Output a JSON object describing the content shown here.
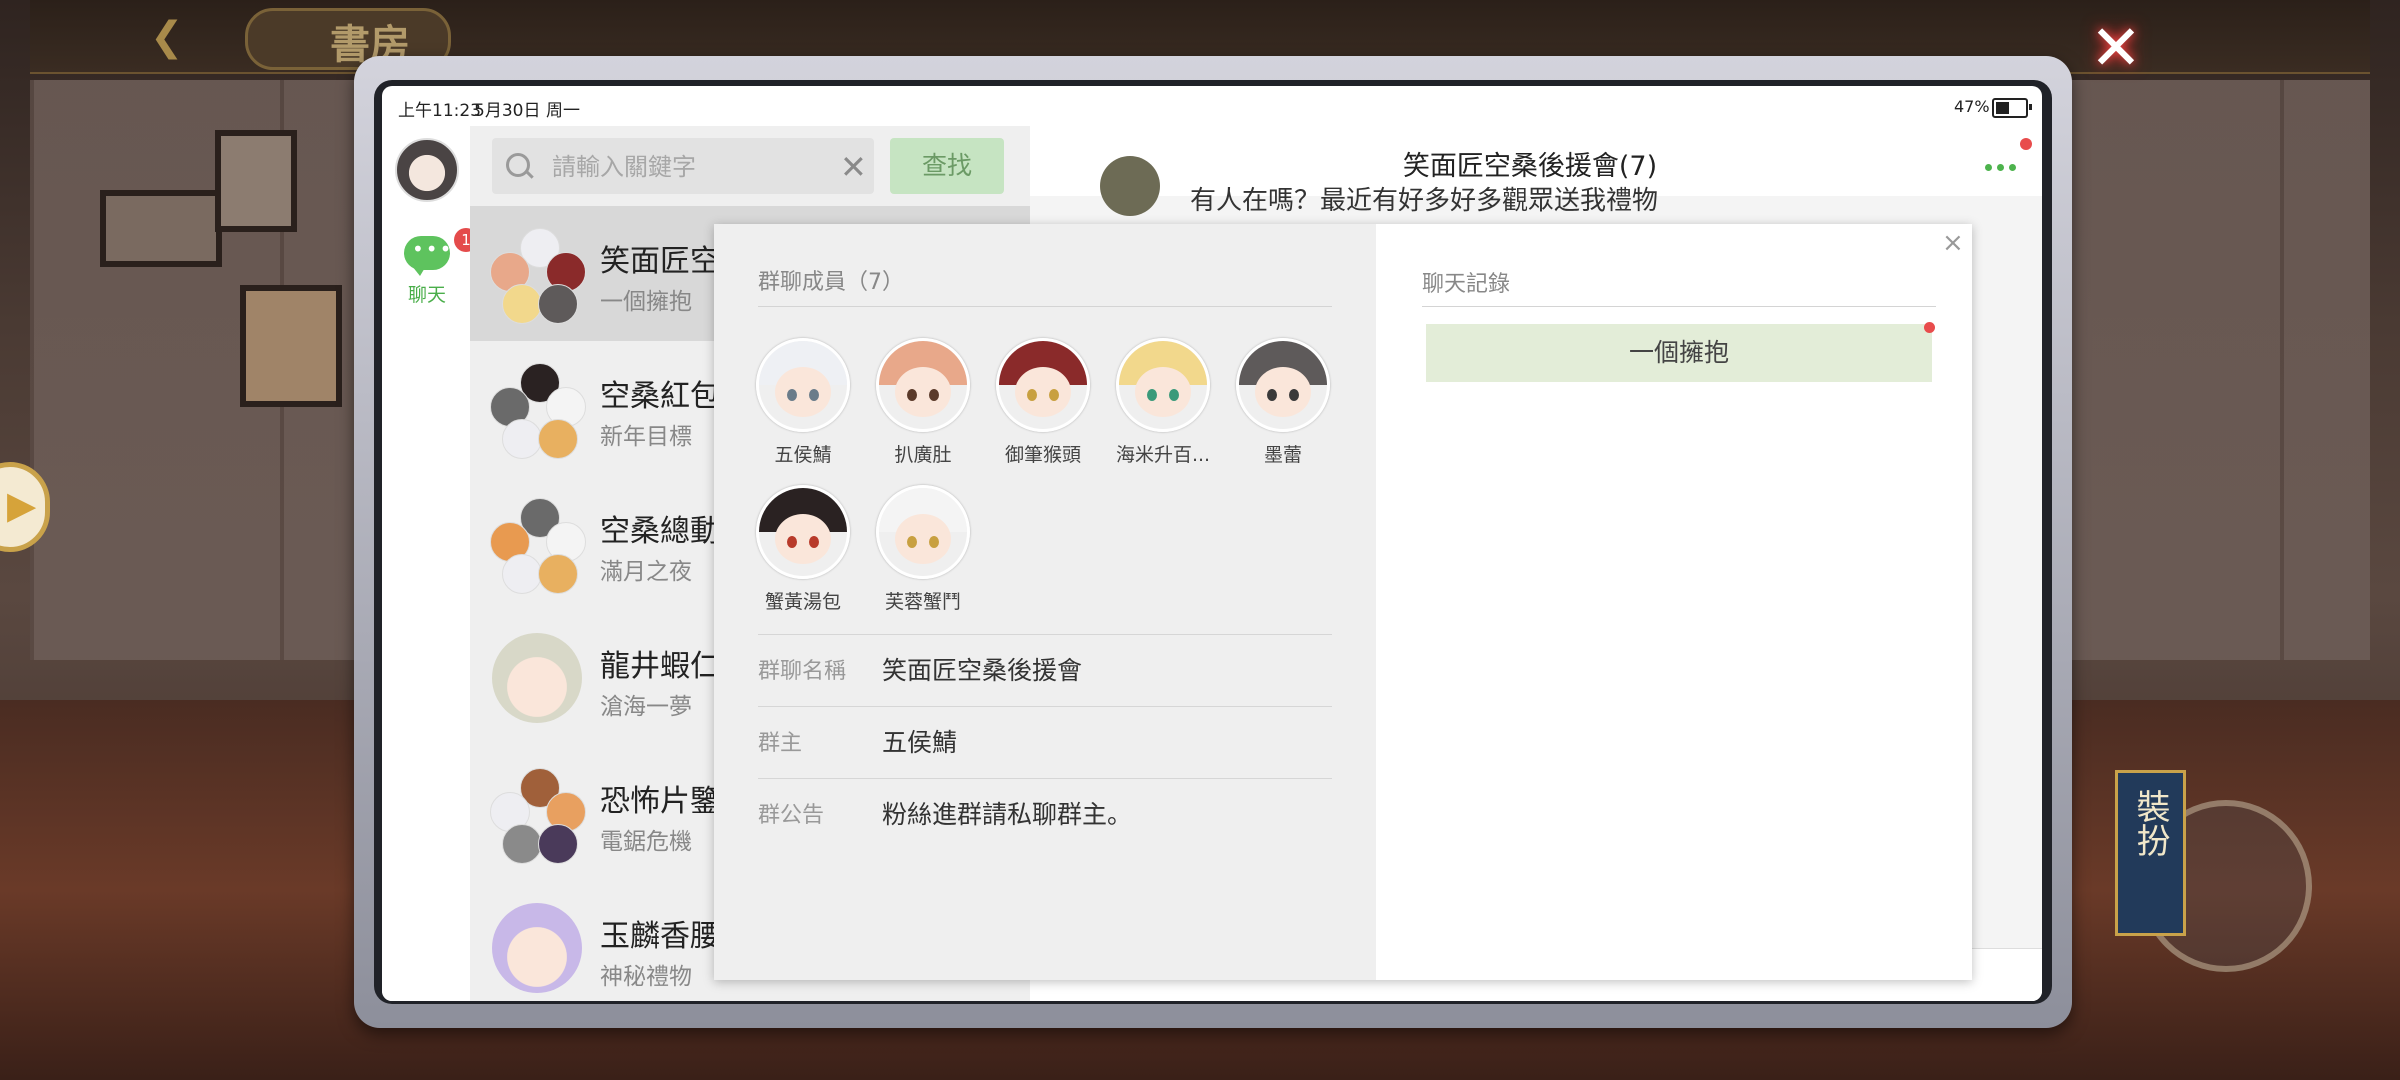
{
  "status": {
    "time": "上午11:23",
    "date": "5月30日",
    "weekday": "周一",
    "battery_text": "47%",
    "battery_level": 0.47
  },
  "background": {
    "title": "書房",
    "dress_label": "裝扮"
  },
  "rail": {
    "chat_label": "聊天",
    "chat_badge": "1"
  },
  "search": {
    "placeholder": "請輸入關鍵字",
    "button": "查找"
  },
  "conversations": [
    {
      "name": "笑面匠空",
      "sub": "一個擁抱"
    },
    {
      "name": "空桑紅包",
      "sub": "新年目標"
    },
    {
      "name": "空桑總動",
      "sub": "滿月之夜"
    },
    {
      "name": "龍井蝦仁",
      "sub": "滄海一夢"
    },
    {
      "name": "恐怖片鑒",
      "sub": "電鋸危機"
    },
    {
      "name": "玉麟香腰",
      "sub": "神秘禮物"
    }
  ],
  "chat": {
    "title": "笑面匠空桑後援會(7)",
    "peek_text": "有人在嗎？最近有好多好多觀眾送我禮物"
  },
  "popup": {
    "members_title": "群聊成員（7）",
    "members": [
      {
        "name": "五侯鯖",
        "hair": "#eef0f4",
        "eye": "#6a7c8a"
      },
      {
        "name": "扒廣肚",
        "hair": "#e8a88a",
        "eye": "#5a3a2a"
      },
      {
        "name": "御筆猴頭",
        "hair": "#8a2a2a",
        "eye": "#c8a040"
      },
      {
        "name": "海米升百...",
        "hair": "#f2d88c",
        "eye": "#3a9a7a"
      },
      {
        "name": "墨蕾",
        "hair": "#5e5a5a",
        "eye": "#3a3a3a"
      },
      {
        "name": "蟹黃湯包",
        "hair": "#2a2222",
        "eye": "#b83a2a"
      },
      {
        "name": "芙蓉蟹鬥",
        "hair": "#f4f4f4",
        "eye": "#c8a040"
      }
    ],
    "group_name_label": "群聊名稱",
    "group_name": "笑面匠空桑後援會",
    "owner_label": "群主",
    "owner": "五侯鯖",
    "notice_label": "群公告",
    "notice": "粉絲進群請私聊群主。",
    "history_title": "聊天記錄",
    "history_items": [
      "一個擁抱"
    ],
    "close_icon": "×"
  },
  "icons": {
    "close": "✕",
    "back": "❮",
    "clear": "✕"
  }
}
